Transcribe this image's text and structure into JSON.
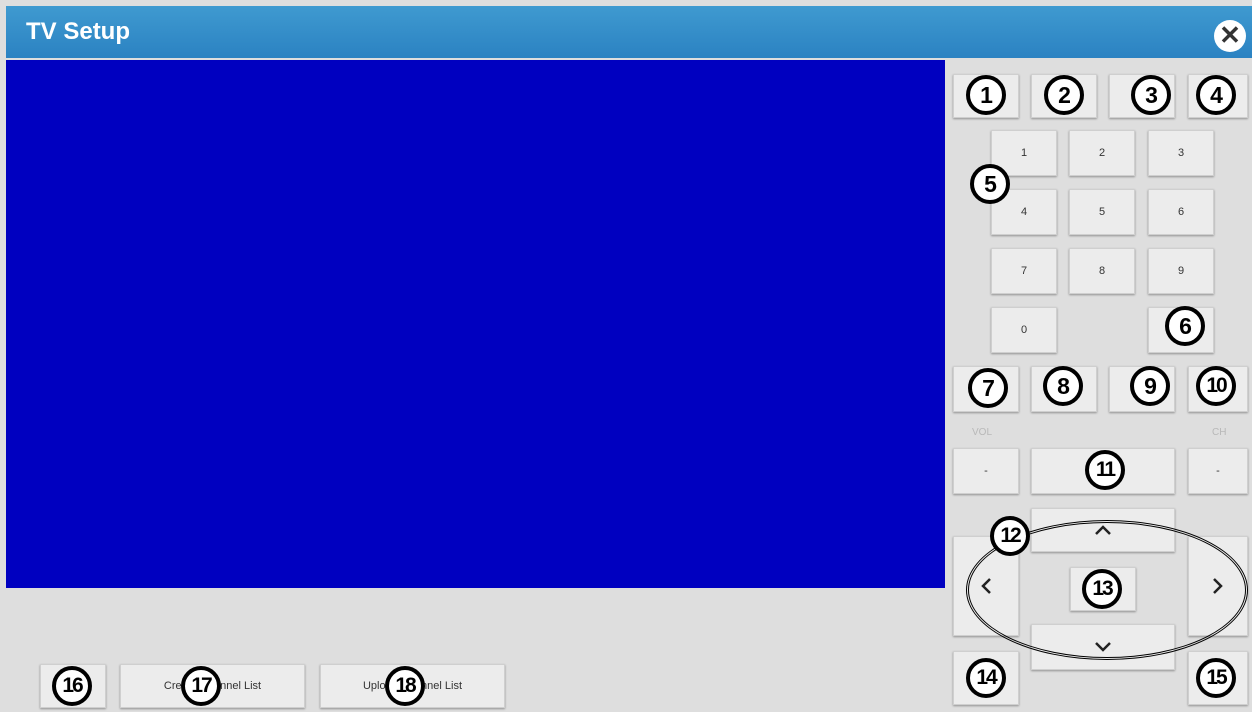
{
  "window": {
    "title": "TV Setup"
  },
  "icons": {
    "close": "close-icon",
    "up": "chevron-up-icon",
    "down": "chevron-down-icon",
    "left": "chevron-left-icon",
    "right": "chevron-right-icon"
  },
  "keypad": {
    "k1": "1",
    "k2": "2",
    "k3": "3",
    "k4": "4",
    "k5": "5",
    "k6": "6",
    "k7": "7",
    "k8": "8",
    "k9": "9",
    "k0": "0"
  },
  "controls": {
    "vol_label": "VOL",
    "ch_label": "CH",
    "vol_minus": "-",
    "ch_minus": "-"
  },
  "bottom": {
    "create_label": "Create Channel List",
    "upload_label": "Upload Channel List"
  },
  "callouts": [
    "1",
    "2",
    "3",
    "4",
    "5",
    "6",
    "7",
    "8",
    "9",
    "10",
    "11",
    "12",
    "13",
    "14",
    "15",
    "16",
    "17",
    "18"
  ],
  "colors": {
    "titlebar": "#2b82c2",
    "screen": "#0000c0",
    "background": "#dedede"
  }
}
